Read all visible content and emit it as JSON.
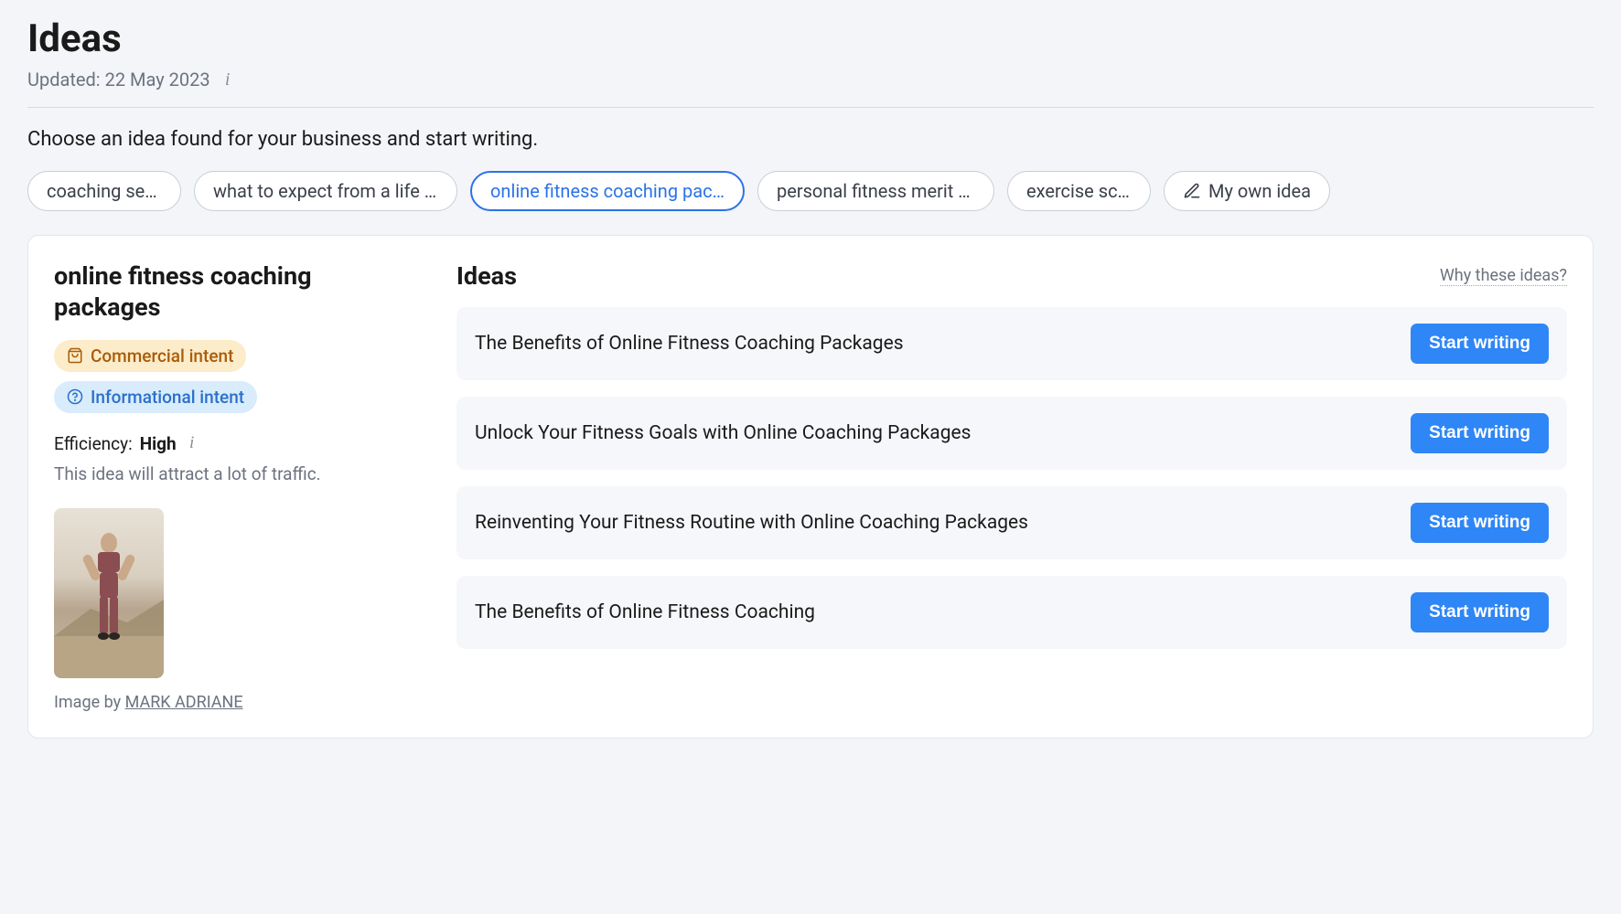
{
  "page": {
    "title": "Ideas",
    "updated": "Updated: 22 May 2023",
    "intro": "Choose an idea found for your business and start writing."
  },
  "chips": [
    {
      "label": "coaching session",
      "active": false
    },
    {
      "label": "what to expect from a life coach",
      "active": false
    },
    {
      "label": "online fitness coaching packages",
      "active": true
    },
    {
      "label": "personal fitness merit badge",
      "active": false
    },
    {
      "label": "exercise science",
      "active": false
    }
  ],
  "own_idea_chip": "My own idea",
  "detail": {
    "title": "online fitness coaching packages",
    "badges": {
      "commercial": "Commercial intent",
      "informational": "Informational intent"
    },
    "efficiency": {
      "label": "Efficiency:",
      "value": "High",
      "desc": "This idea will attract a lot of traffic."
    },
    "image_credit_prefix": "Image by ",
    "image_author": "MARK ADRIANE"
  },
  "right": {
    "title": "Ideas",
    "why_link": "Why these ideas?",
    "start_label": "Start writing",
    "items": [
      "The Benefits of Online Fitness Coaching Packages",
      "Unlock Your Fitness Goals with Online Coaching Packages",
      "Reinventing Your Fitness Routine with Online Coaching Packages",
      "The Benefits of Online Fitness Coaching"
    ]
  }
}
